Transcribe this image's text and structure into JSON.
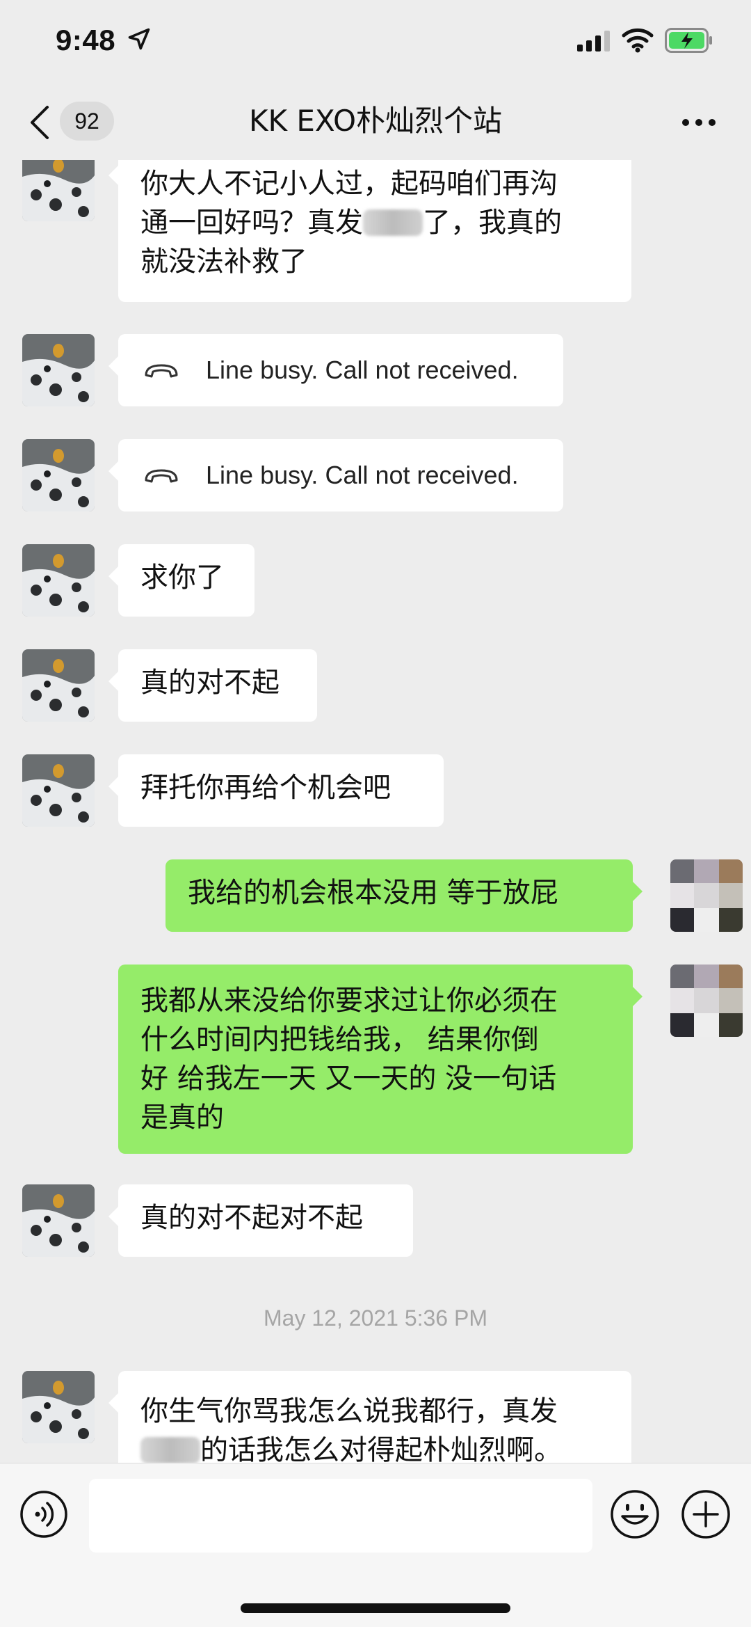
{
  "status_bar": {
    "time": "9:48"
  },
  "nav": {
    "back_label": "<",
    "unread_count": "92",
    "title": "KK EXO朴灿烈个站",
    "more_icon": "more-dots-icon"
  },
  "messages": [
    {
      "side": "left",
      "type": "text",
      "lines": [
        "你大人不记小人过，起码咱们再沟",
        "通一回好吗？真发[blur]了，我真的",
        "就没法补救了"
      ]
    },
    {
      "side": "left",
      "type": "call",
      "text": "Line busy. Call not received."
    },
    {
      "side": "left",
      "type": "call",
      "text": "Line busy. Call not received."
    },
    {
      "side": "left",
      "type": "text",
      "lines": [
        "求你了"
      ]
    },
    {
      "side": "left",
      "type": "text",
      "lines": [
        "真的对不起"
      ]
    },
    {
      "side": "left",
      "type": "text",
      "lines": [
        "拜托你再给个机会吧"
      ]
    },
    {
      "side": "right",
      "type": "text",
      "lines": [
        "我给的机会根本没用 等于放屁"
      ]
    },
    {
      "side": "right",
      "type": "text",
      "lines": [
        "我都从来没给你要求过让你必须在",
        "什么时间内把钱给我， 结果你倒",
        "好 给我左一天 又一天的 没一句话",
        "是真的"
      ]
    },
    {
      "side": "left",
      "type": "text",
      "lines": [
        "真的对不起对不起"
      ]
    },
    {
      "side": "system",
      "type": "timestamp",
      "text": "May 12, 2021 5:36 PM"
    },
    {
      "side": "left",
      "type": "text",
      "lines": [
        "你生气你骂我怎么说我都行，真发",
        "[blur]的话我怎么对得起朴灿烈啊。"
      ]
    }
  ],
  "input_bar": {
    "voice_icon": "voice-icon",
    "emoji_icon": "emoji-icon",
    "plus_icon": "plus-icon",
    "input_value": ""
  },
  "colors": {
    "background": "#ededed",
    "outgoing_bubble": "#95ec69",
    "incoming_bubble": "#ffffff",
    "timestamp_text": "#a5a5a5"
  }
}
